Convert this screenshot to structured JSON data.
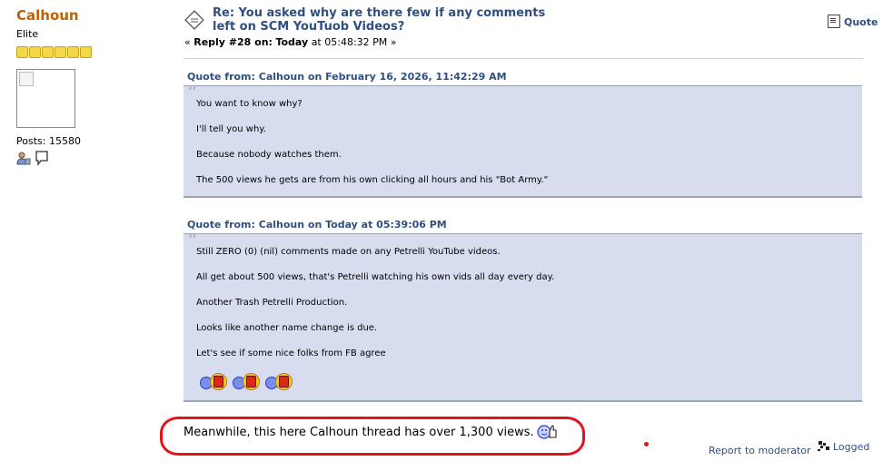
{
  "poster": {
    "name": "Calhoun",
    "title": "Elite",
    "stars": 6,
    "posts_label": "Posts: 15580",
    "icons": [
      "profile-icon",
      "personal-message-icon"
    ]
  },
  "post": {
    "subject_icon": "topic-icon",
    "subject": "Re: You asked why are there few if any comments left on SCM YouTuob Videos?",
    "reply_prefix": "«",
    "reply_label": "Reply #28 on:",
    "reply_day": "Today",
    "reply_time": "at 05:48:32 PM",
    "reply_suffix": "»",
    "quote_button": "Quote"
  },
  "quotes": [
    {
      "header": "Quote from: Calhoun on February 16, 2026, 11:42:29 AM",
      "lines": [
        "You want to know why?",
        "I'll tell you why.",
        "Because nobody watches them.",
        "The 500 views he gets are from his own clicking all hours and his \"Bot Army.\""
      ]
    },
    {
      "header": "Quote from: Calhoun on Today at 05:39:06 PM",
      "lines": [
        "Still ZERO (0) (nil) comments made on any Petrelli YouTube videos.",
        "All get about 500 views, that's Petrelli watching his own vids all day every day.",
        "Another Trash Petrelli Production.",
        "Looks like another name change is due.",
        "Let's see if some nice folks from FB agree"
      ],
      "smileys": [
        "reading-smiley-icon",
        "reading-smiley-icon",
        "reading-smiley-icon"
      ]
    }
  ],
  "body_text": "Meanwhile, this here Calhoun thread has over 1,300 views.",
  "body_icon": "thumbs-up-smiley-icon",
  "footer": {
    "report": "Report to moderator",
    "logged": "Logged"
  },
  "colors": {
    "username": "#c06002",
    "link": "#2f4f82",
    "quote_bg": "#d8dcef",
    "highlight_oval": "#e3131b"
  }
}
